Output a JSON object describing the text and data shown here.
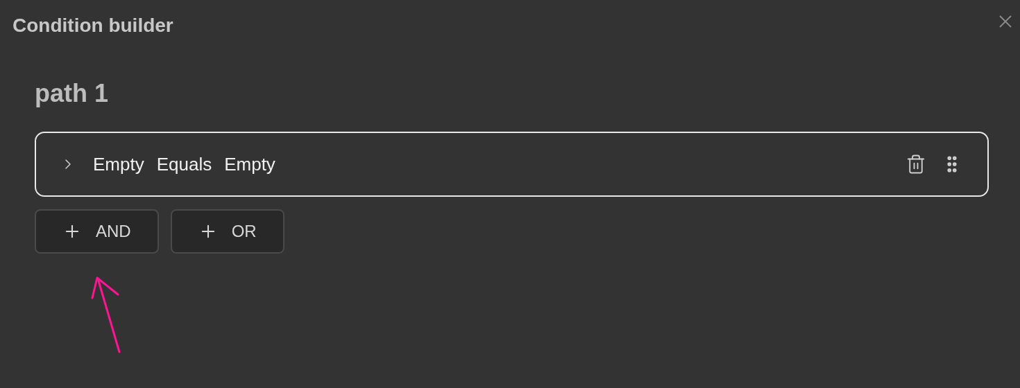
{
  "dialog": {
    "title": "Condition builder"
  },
  "path": {
    "title": "path 1"
  },
  "conditions": [
    {
      "expanded": false,
      "parts": [
        "Empty",
        "Equals",
        "Empty"
      ]
    }
  ],
  "add_buttons": [
    {
      "label": "AND"
    },
    {
      "label": "OR"
    }
  ]
}
